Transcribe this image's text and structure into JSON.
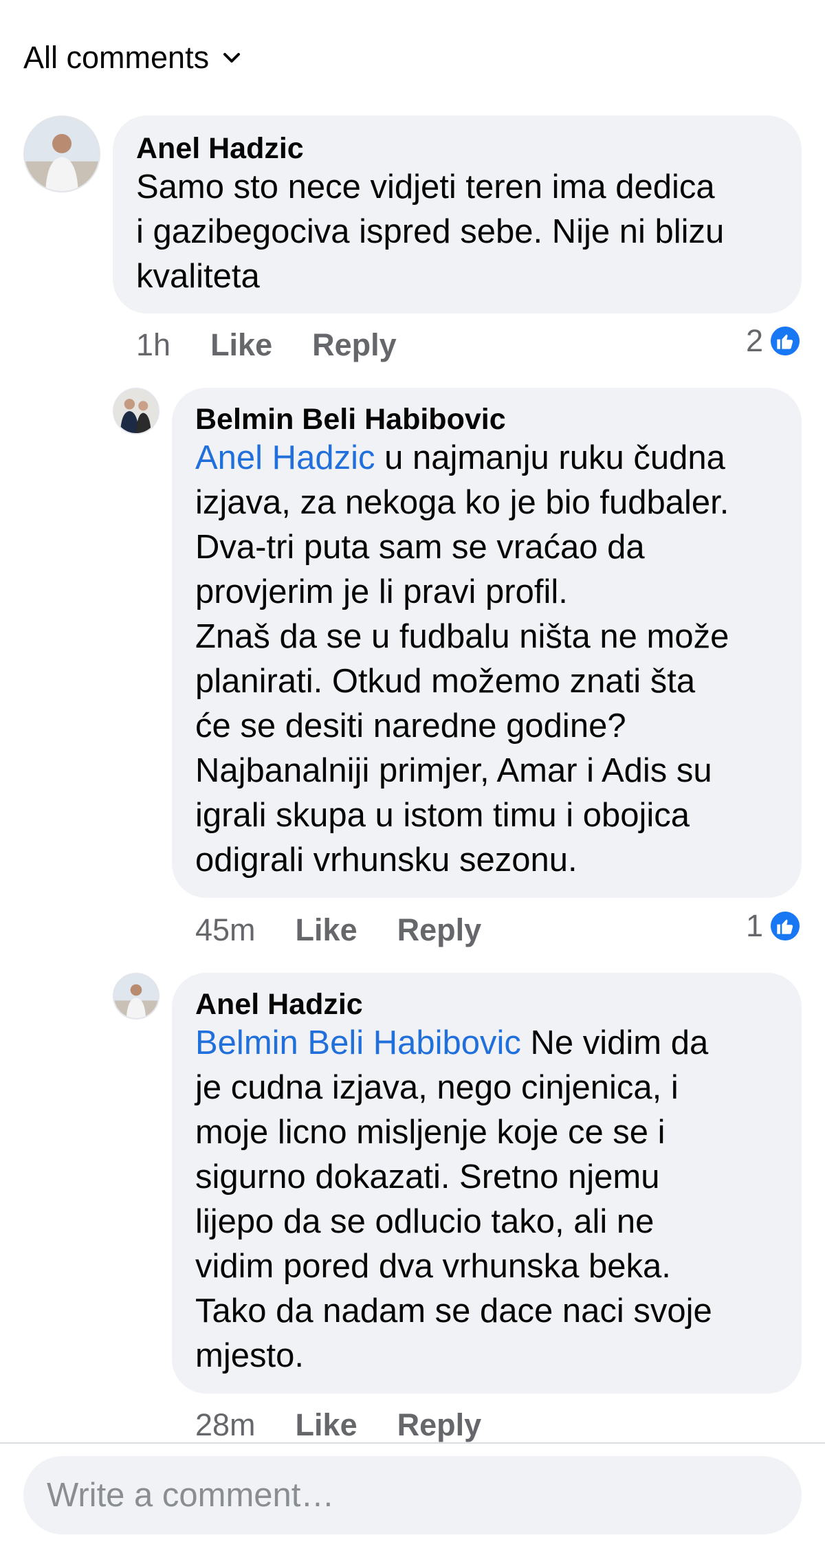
{
  "filter": {
    "label": "All comments"
  },
  "comments": [
    {
      "author": "Anel Hadzic",
      "mention": "",
      "lines": [
        "Samo sto nece vidjeti teren ima dedica",
        "i gazibegociva ispred sebe. Nije ni blizu",
        "kvaliteta"
      ],
      "time": "1h",
      "like_label": "Like",
      "reply_label": "Reply",
      "reaction_count": "2"
    },
    {
      "author": "Belmin Beli Habibovic",
      "mention": "Anel Hadzic",
      "lines": [
        " u najmanju ruku čudna",
        "izjava, za nekoga ko je bio fudbaler.",
        "Dva-tri puta sam se vraćao da",
        "provjerim je li pravi profil.",
        "Znaš da se u fudbalu ništa ne može",
        "planirati. Otkud možemo znati šta",
        "će se desiti naredne godine?",
        "Najbanalniji primjer, Amar i Adis su",
        "igrali skupa u istom timu i obojica",
        "odigrali vrhunsku sezonu."
      ],
      "time": "45m",
      "like_label": "Like",
      "reply_label": "Reply",
      "reaction_count": "1"
    },
    {
      "author": "Anel Hadzic",
      "mention": "Belmin Beli Habibovic",
      "lines": [
        " Ne vidim da",
        "je cudna izjava, nego cinjenica, i",
        "moje licno misljenje koje ce se i",
        "sigurno dokazati. Sretno njemu",
        "lijepo da se odlucio tako, ali ne",
        "vidim pored dva vrhunska beka.",
        "Tako da nadam se dace naci svoje",
        "mjesto."
      ],
      "time": "28m",
      "like_label": "Like",
      "reply_label": "Reply",
      "reaction_count": ""
    }
  ],
  "composer": {
    "placeholder": "Write a comment…"
  },
  "colors": {
    "mention": "#216fdb",
    "bubble": "#f0f2f5",
    "like_badge": "#1877f2",
    "meta": "#65676b"
  },
  "icons": {
    "filter_chevron": "chevron-down-icon",
    "reaction": "thumbs-up-icon",
    "avatar": "user-photo"
  }
}
